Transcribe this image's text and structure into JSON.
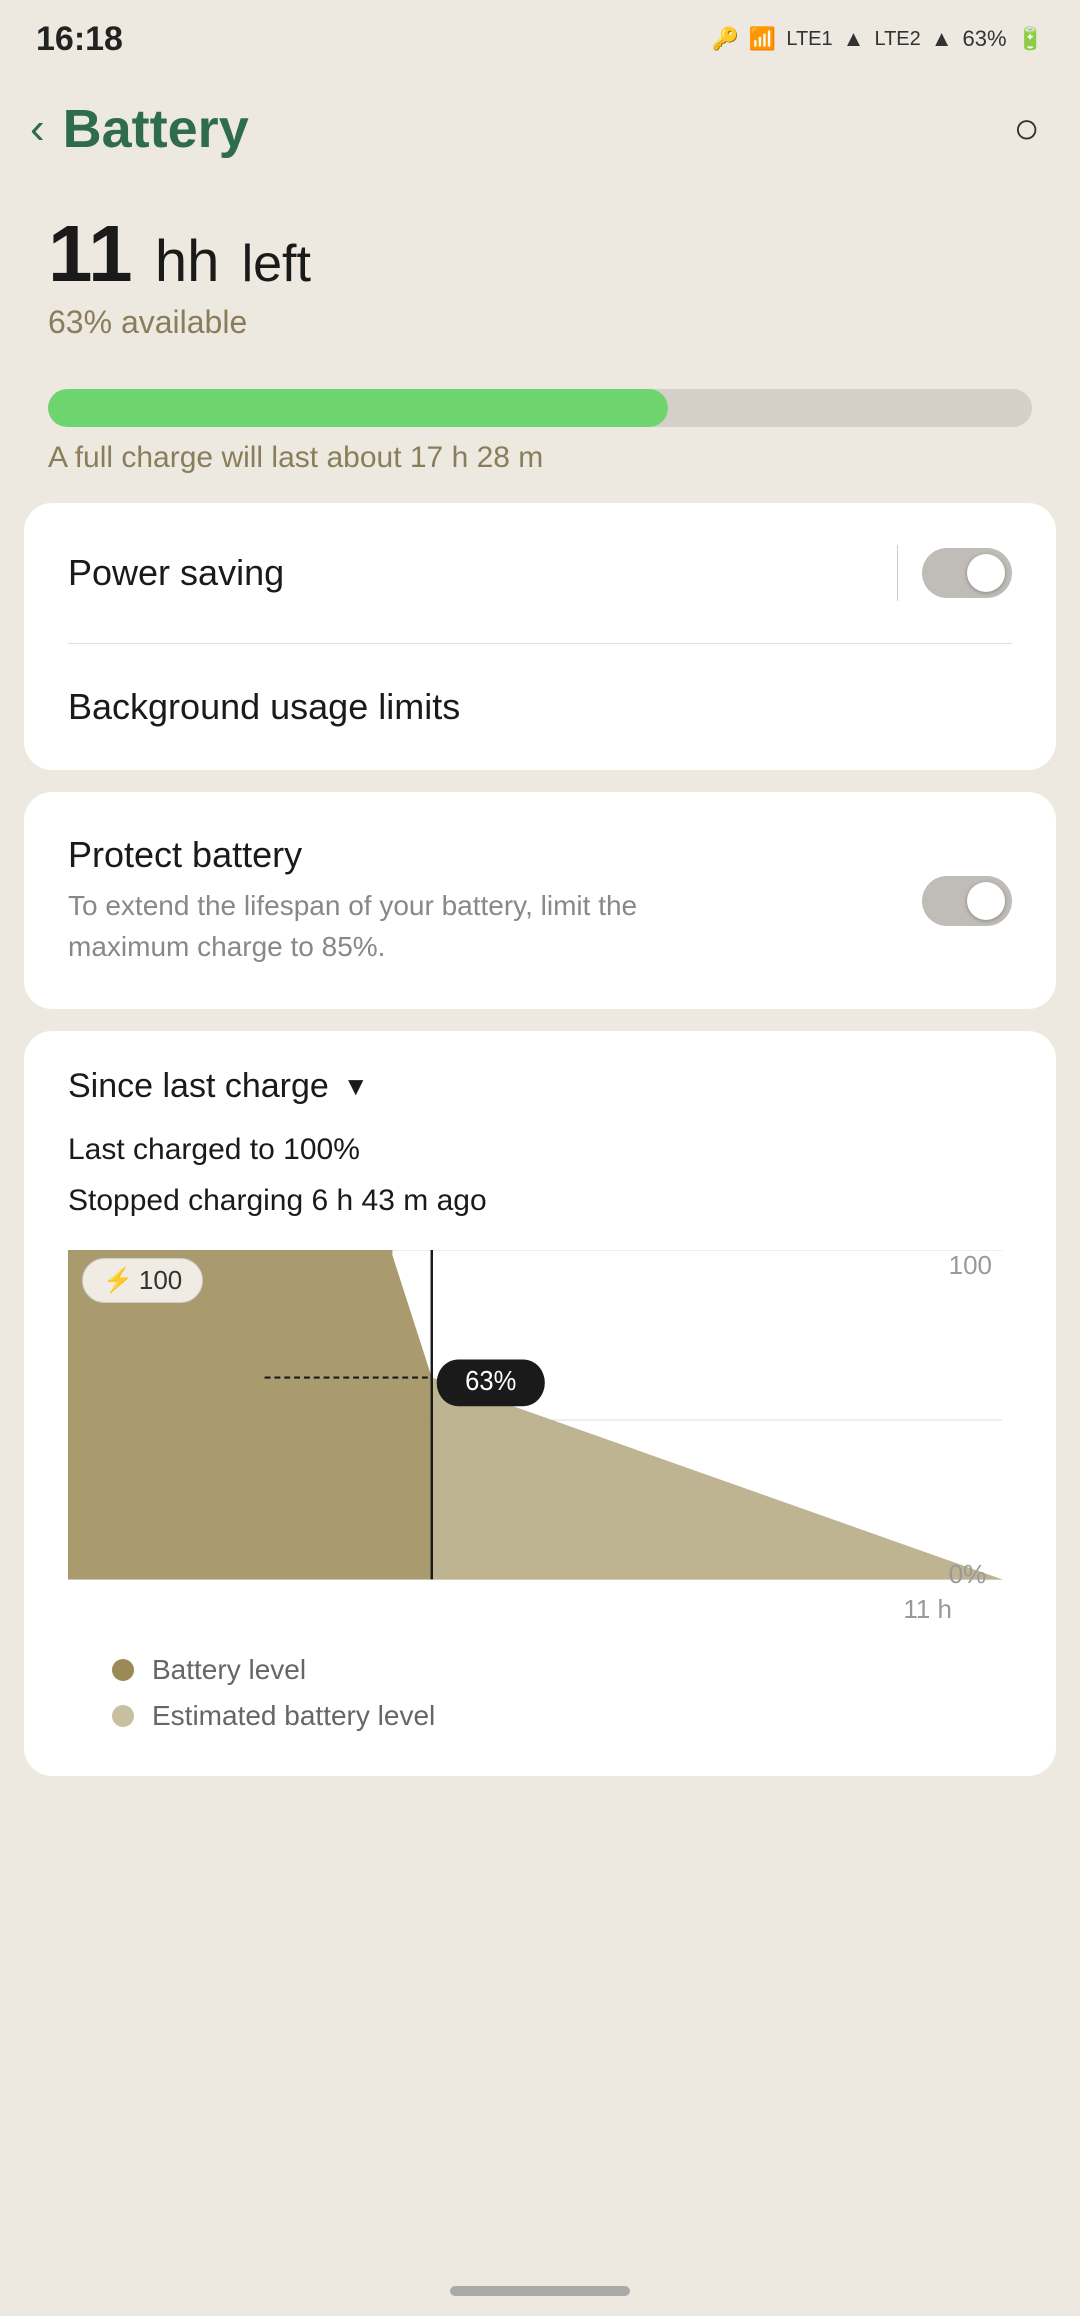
{
  "statusBar": {
    "time": "16:18",
    "batteryPercent": "63%"
  },
  "header": {
    "backLabel": "‹",
    "title": "Battery",
    "searchLabel": "⌕"
  },
  "batteryStatus": {
    "hoursLeft": "11",
    "unit": "h",
    "leftLabel": "left",
    "percentAvailable": "63% available",
    "progressPercent": 63,
    "fullChargeNote": "A full charge will last about 17 h 28 m"
  },
  "powerSaving": {
    "label": "Power saving",
    "enabled": false
  },
  "backgroundUsage": {
    "label": "Background usage limits"
  },
  "protectBattery": {
    "title": "Protect battery",
    "description": "To extend the lifespan of your battery, limit the maximum charge to 85%.",
    "enabled": false
  },
  "sinceLastCharge": {
    "sectionTitle": "Since last charge",
    "lastChargedLine": "Last charged to 100%",
    "stoppedChargingLine": "Stopped charging 6 h 43 m ago",
    "badge": "⚡ 100",
    "currentPercent": "63%",
    "yLabels": [
      "100",
      "0%"
    ],
    "xLabel": "11 h"
  },
  "legend": {
    "items": [
      {
        "label": "Battery level",
        "dotClass": "dot-actual"
      },
      {
        "label": "Estimated battery level",
        "dotClass": "dot-estimated"
      }
    ]
  }
}
